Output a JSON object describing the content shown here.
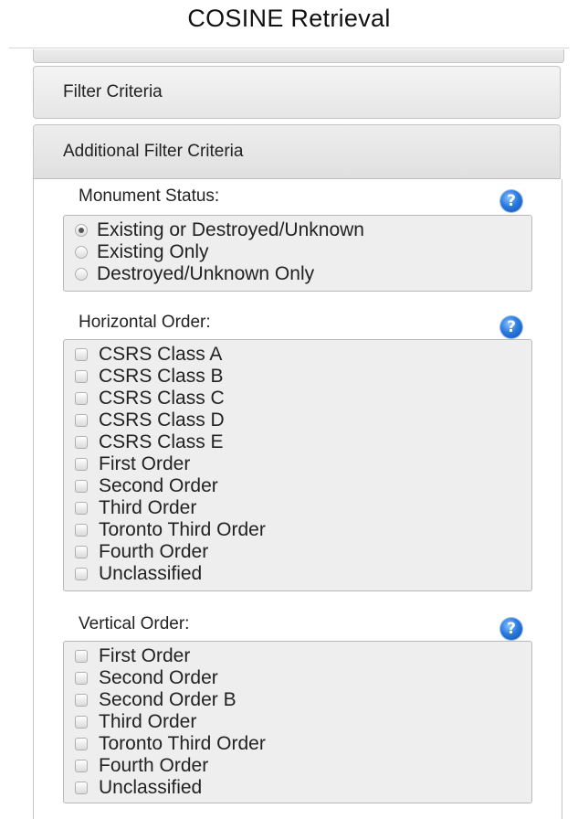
{
  "page": {
    "title": "COSINE Retrieval"
  },
  "accordion": {
    "filter_criteria": "Filter Criteria",
    "additional_filter_criteria": "Additional Filter Criteria"
  },
  "monument_status": {
    "label": "Monument Status:",
    "selected": "Existing or Destroyed/Unknown",
    "options": [
      "Existing or Destroyed/Unknown",
      "Existing Only",
      "Destroyed/Unknown Only"
    ]
  },
  "horizontal_order": {
    "label": "Horizontal Order:",
    "options": [
      "CSRS Class A",
      "CSRS Class B",
      "CSRS Class C",
      "CSRS Class D",
      "CSRS Class E",
      "First Order",
      "Second Order",
      "Third Order",
      "Toronto Third Order",
      "Fourth Order",
      "Unclassified"
    ]
  },
  "vertical_order": {
    "label": "Vertical Order:",
    "options": [
      "First Order",
      "Second Order",
      "Second Order B",
      "Third Order",
      "Toronto Third Order",
      "Fourth Order",
      "Unclassified"
    ]
  },
  "icons": {
    "help": "help-icon"
  },
  "colors": {
    "help_icon": "#2a7be0",
    "panel_bg": "#eeeeee",
    "header_bg": "#e6e6e6"
  }
}
